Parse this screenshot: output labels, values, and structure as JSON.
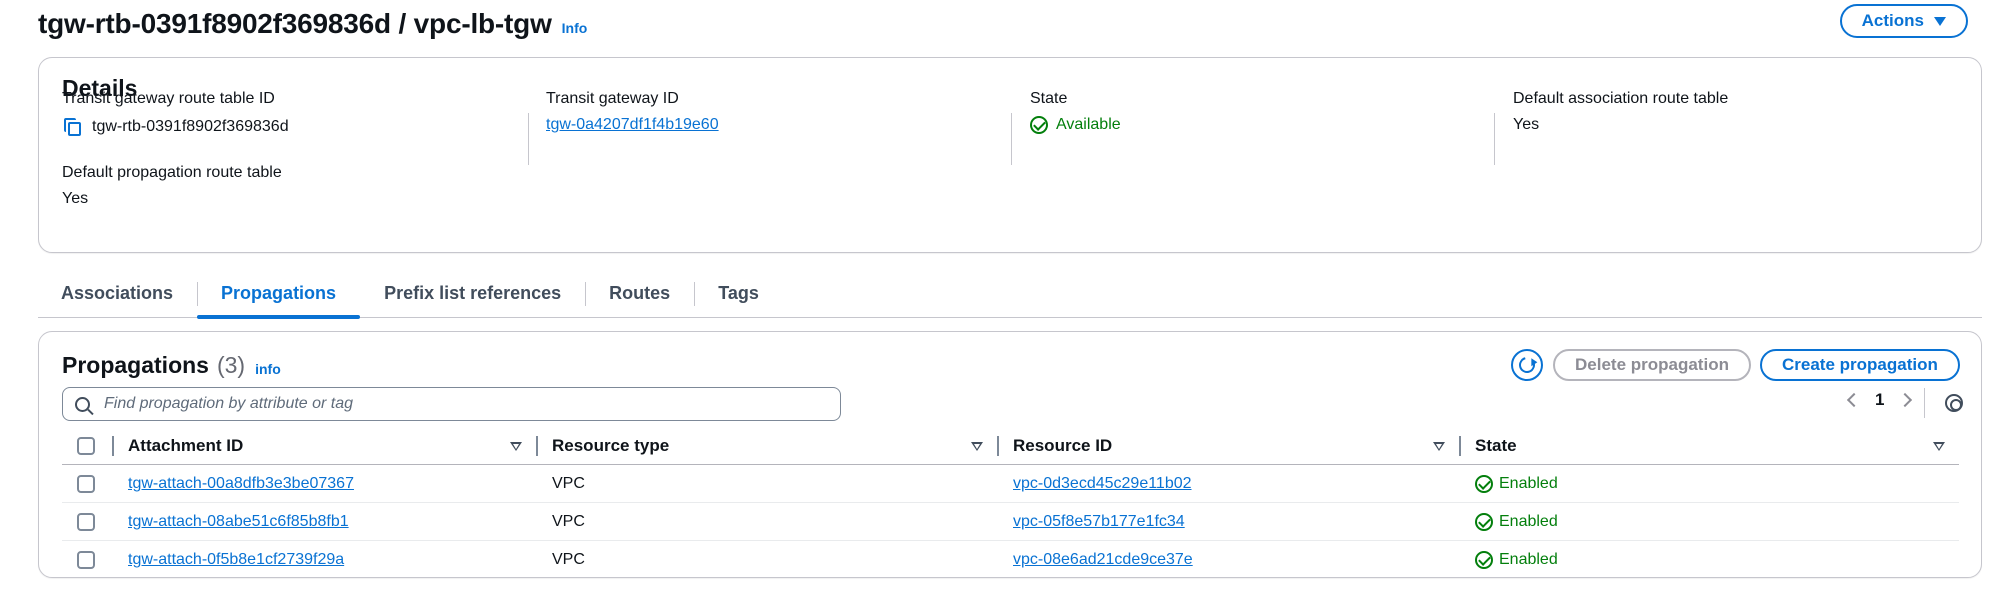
{
  "header": {
    "title": "tgw-rtb-0391f8902f369836d / vpc-lb-tgw",
    "info": "Info",
    "actions_label": "Actions"
  },
  "details": {
    "title": "Details",
    "fields": [
      {
        "label": "Transit gateway route table ID",
        "value": "tgw-rtb-0391f8902f369836d"
      },
      {
        "label": "Transit gateway ID",
        "value": "tgw-0a4207df1f4b19e60"
      },
      {
        "label": "State",
        "value": "Available"
      },
      {
        "label": "Default association route table",
        "value": "Yes"
      },
      {
        "label": "Default propagation route table",
        "value": "Yes"
      }
    ]
  },
  "tabs": [
    "Associations",
    "Propagations",
    "Prefix list references",
    "Routes",
    "Tags"
  ],
  "active_tab": "Propagations",
  "propagations": {
    "title": "Propagations",
    "count": "(3)",
    "info": "info",
    "delete_label": "Delete propagation",
    "create_label": "Create propagation",
    "search_placeholder": "Find propagation by attribute or tag",
    "page": "1",
    "columns": [
      "Attachment ID",
      "Resource type",
      "Resource ID",
      "State"
    ],
    "rows": [
      {
        "attachment_id": "tgw-attach-00a8dfb3e3be07367",
        "resource_type": "VPC",
        "resource_id": "vpc-0d3ecd45c29e11b02",
        "state": "Enabled"
      },
      {
        "attachment_id": "tgw-attach-08abe51c6f85b8fb1",
        "resource_type": "VPC",
        "resource_id": "vpc-05f8e57b177e1fc34",
        "state": "Enabled"
      },
      {
        "attachment_id": "tgw-attach-0f5b8e1cf2739f29a",
        "resource_type": "VPC",
        "resource_id": "vpc-08e6ad21cde9ce37e",
        "state": "Enabled"
      }
    ]
  },
  "icons": [
    "copy-icon",
    "check-circle-icon",
    "refresh-icon",
    "search-icon",
    "chevron-left-icon",
    "chevron-right-icon",
    "gear-icon",
    "caret-down-icon",
    "sort-icon"
  ],
  "colors": {
    "accent": "#0972d3",
    "success": "#037f0c",
    "border": "#c6c6cd",
    "disabled": "#8c8c94"
  }
}
